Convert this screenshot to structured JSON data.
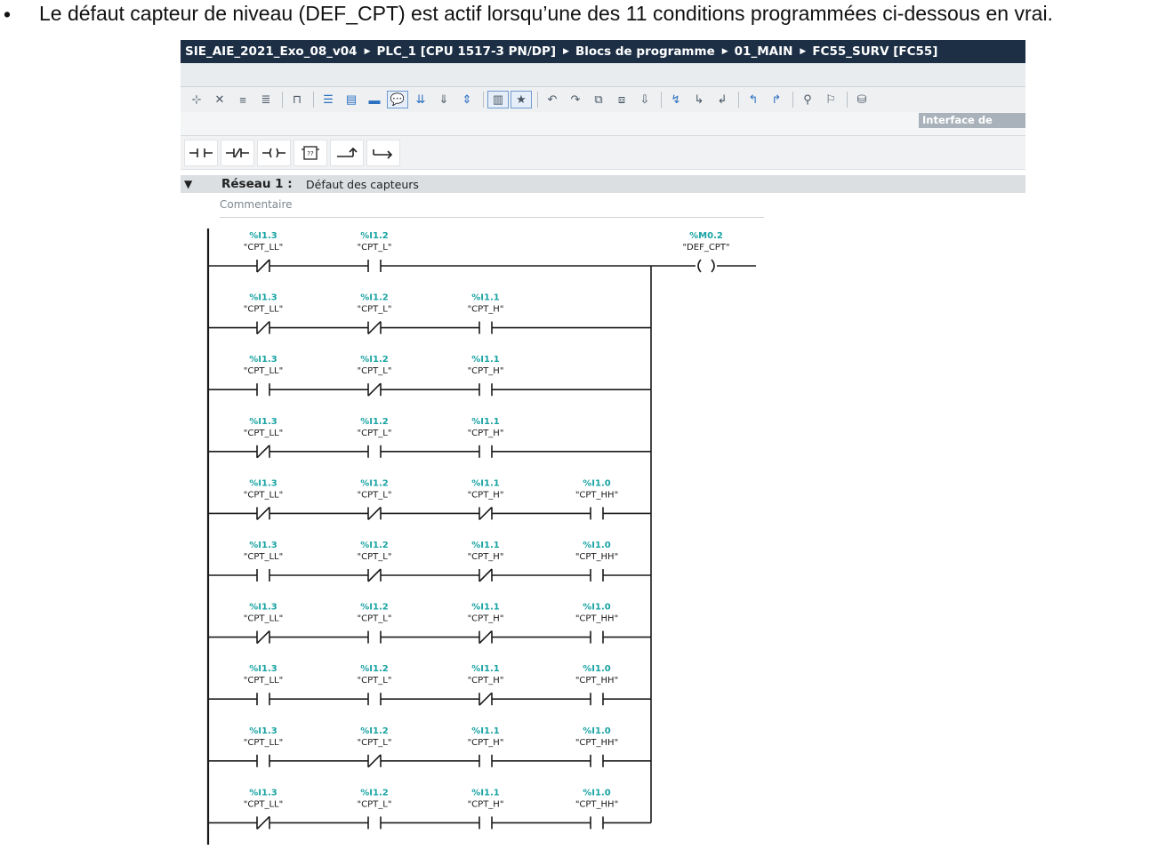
{
  "instruction": {
    "bullet": "•",
    "text": "Le défaut capteur de niveau (DEF_CPT) est actif lorsqu’une des 11 conditions programmées ci-dessous en vrai."
  },
  "breadcrumb": [
    "SIE_AIE_2021_Exo_08_v04",
    "PLC_1 [CPU 1517-3 PN/DP]",
    "Blocs de programme",
    "01_MAIN",
    "FC55_SURV [FC55]"
  ],
  "interface_label": "Interface de",
  "network": {
    "title": "Réseau 1 :",
    "subtitle": "Défaut des capteurs",
    "comment": "Commentaire"
  },
  "colors": {
    "address": "#1aa3a3",
    "header": "#1c2f45"
  },
  "contacts": {
    "c1": {
      "address": "%I1.3",
      "symbol": "\"CPT_LL\""
    },
    "c2": {
      "address": "%I1.2",
      "symbol": "\"CPT_L\""
    },
    "c3": {
      "address": "%I1.1",
      "symbol": "\"CPT_H\""
    },
    "c4": {
      "address": "%I1.0",
      "symbol": "\"CPT_HH\""
    }
  },
  "coil": {
    "address": "%M0.2",
    "symbol": "\"DEF_CPT\""
  },
  "rungs": [
    [
      "NC",
      "NO",
      null,
      null
    ],
    [
      "NC",
      "NC",
      "NO",
      null
    ],
    [
      "NO",
      "NC",
      "NO",
      null
    ],
    [
      "NC",
      "NO",
      "NO",
      null
    ],
    [
      "NC",
      "NC",
      "NC",
      "NO"
    ],
    [
      "NO",
      "NC",
      "NC",
      "NO"
    ],
    [
      "NC",
      "NO",
      "NC",
      "NO"
    ],
    [
      "NO",
      "NO",
      "NC",
      "NO"
    ],
    [
      "NO",
      "NC",
      "NO",
      "NO"
    ],
    [
      "NC",
      "NO",
      "NO",
      "NO"
    ]
  ]
}
